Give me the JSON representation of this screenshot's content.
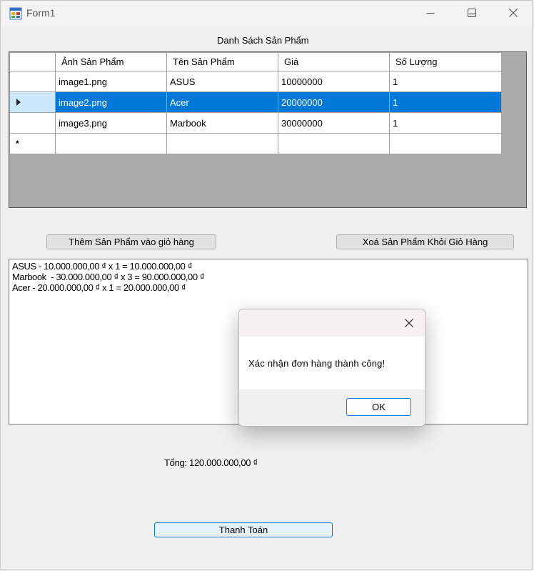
{
  "window": {
    "title": "Form1"
  },
  "product_list": {
    "title": "Danh Sách Sản Phẩm",
    "columns": [
      "Ảnh Sản Phẩm",
      "Tên Sản Phẩm",
      "Giá",
      "Số Lượng"
    ],
    "rows": [
      {
        "image": "image1.png",
        "name": "ASUS",
        "price": "10000000",
        "qty": "1",
        "selected": false
      },
      {
        "image": "image2.png",
        "name": "Acer",
        "price": "20000000",
        "qty": "1",
        "selected": true
      },
      {
        "image": "image3.png",
        "name": "Marbook",
        "price": "30000000",
        "qty": "1",
        "selected": false
      }
    ],
    "new_row_marker": "*"
  },
  "buttons": {
    "add_to_cart": "Thêm Sản Phẩm vào giỏ hàng",
    "remove_from_cart": "Xoá Sản Phẩm Khỏi Giỏ Hàng",
    "checkout": "Thanh Toán"
  },
  "cart": {
    "lines": [
      "ASUS - 10.000.000,00 ₫ x 1 = 10.000.000,00 ₫",
      "Marbook  - 30.000.000,00 ₫ x 3 = 90.000.000,00 ₫",
      "Acer - 20.000.000,00 ₫ x 1 = 20.000.000,00 ₫"
    ]
  },
  "total": {
    "text": "Tổng: 120.000.000,00 ₫"
  },
  "dialog": {
    "message": "Xác nhận đơn hàng thành công!",
    "ok_label": "OK"
  },
  "colors": {
    "selection": "#0078d7",
    "row_header_selected": "#cce8ff",
    "grid_background": "#ababab"
  }
}
